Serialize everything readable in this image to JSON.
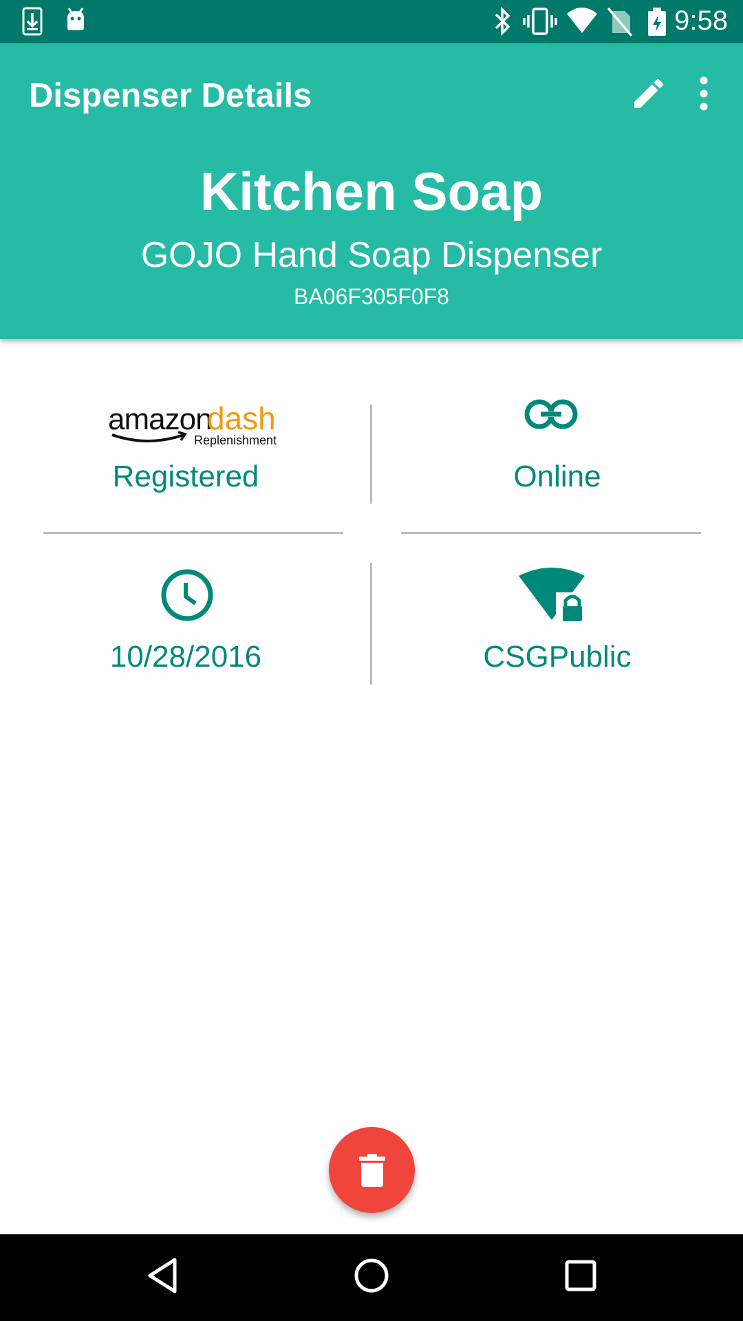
{
  "status_bar": {
    "time": "9:58",
    "icons": [
      "download-icon",
      "android-icon",
      "bluetooth-icon",
      "vibrate-icon",
      "wifi-icon",
      "no-sim-icon",
      "battery-charging-icon"
    ]
  },
  "app_bar": {
    "title": "Dispenser Details",
    "actions": [
      "edit-icon",
      "more-vert-icon"
    ],
    "background_color": "#26bba4"
  },
  "device": {
    "name": "Kitchen Soap",
    "type": "GOJO Hand Soap Dispenser",
    "id": "BA06F305F0F8"
  },
  "details": {
    "dash_logo": {
      "word1": "amazon",
      "word2": "dash",
      "subtitle": "Replenishment"
    },
    "registration_status": "Registered",
    "connection_status": "Online",
    "last_updated": "10/28/2016",
    "network": "CSGPublic",
    "accent_color": "#00897b"
  },
  "fab": {
    "icon": "delete-icon",
    "color": "#ef453b"
  },
  "nav_bar": {
    "buttons": [
      "back-icon",
      "home-icon",
      "recents-icon"
    ]
  }
}
